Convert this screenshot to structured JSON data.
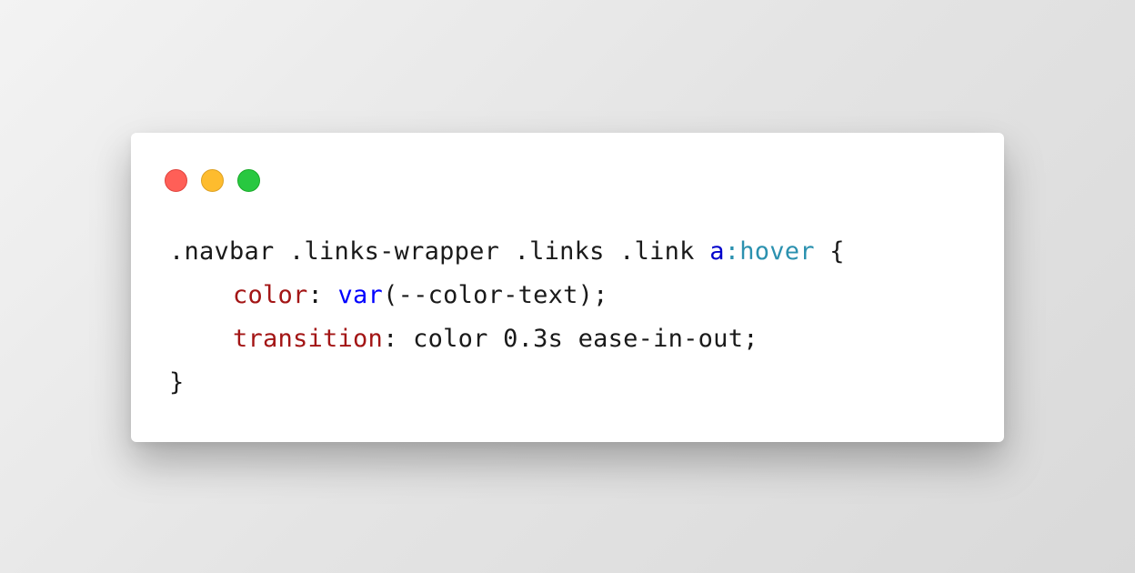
{
  "window": {
    "traffic_lights": [
      {
        "name": "close",
        "color": "#ff5f57",
        "border": "#e0443e"
      },
      {
        "name": "minimize",
        "color": "#febc2e",
        "border": "#dea123"
      },
      {
        "name": "maximize",
        "color": "#28c840",
        "border": "#1aab29"
      }
    ]
  },
  "code": {
    "selector": ".navbar .links-wrapper .links .link ",
    "selector_tag": "a",
    "selector_pseudo": ":hover",
    "open_brace": " {",
    "prop1_name": "color",
    "prop1_colon": ": ",
    "prop1_func": "var",
    "prop1_args": "(--color-text);",
    "prop2_name": "transition",
    "prop2_colon": ": ",
    "prop2_value": "color 0.3s ease-in-out;",
    "close_brace": "}"
  },
  "colors": {
    "text": "#1a1a1a",
    "tag": "#0000cc",
    "pseudo": "#2b91af",
    "property": "#a31515",
    "function": "#0000ff"
  }
}
